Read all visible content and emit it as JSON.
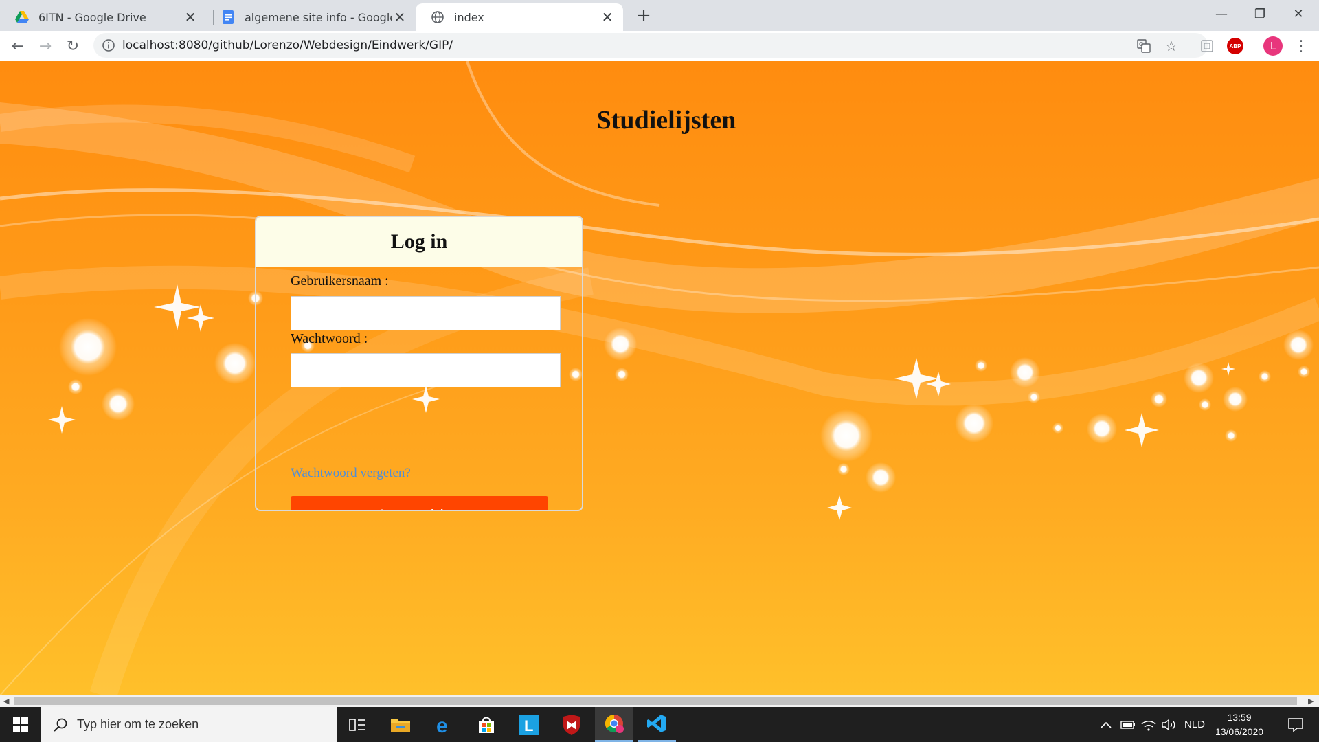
{
  "browser": {
    "tabs": [
      {
        "title": "6ITN - Google Drive",
        "active": false,
        "icon": "google-drive-icon"
      },
      {
        "title": "algemene site info - Google Docs",
        "active": false,
        "icon": "google-docs-icon"
      },
      {
        "title": "index",
        "active": true,
        "icon": "globe-icon"
      }
    ],
    "url": "localhost:8080/github/Lorenzo/Webdesign/Eindwerk/GIP/",
    "avatar_letter": "L",
    "extension_label": "ABP"
  },
  "page": {
    "title": "Studielijsten",
    "login": {
      "heading": "Log in",
      "username_label": "Gebruikersnaam :",
      "username_value": "",
      "password_label": "Wachtwoord :",
      "password_value": "",
      "forgot_link": "Wachtwoord vergeten?",
      "submit_label": "Aanmelden"
    },
    "colors": {
      "background_top": "#ff8c0f",
      "background_bottom": "#ffc02a",
      "button": "#ff4500",
      "header_bg": "#fdfde8",
      "link": "#4f8ed8"
    }
  },
  "taskbar": {
    "search_placeholder": "Typ hier om te zoeken",
    "apps": [
      "task-view-icon",
      "file-explorer-icon",
      "edge-icon",
      "store-icon",
      "l-app-icon",
      "mcafee-icon",
      "chrome-icon",
      "vscode-icon"
    ],
    "language": "NLD",
    "time": "13:59",
    "date": "13/06/2020"
  }
}
